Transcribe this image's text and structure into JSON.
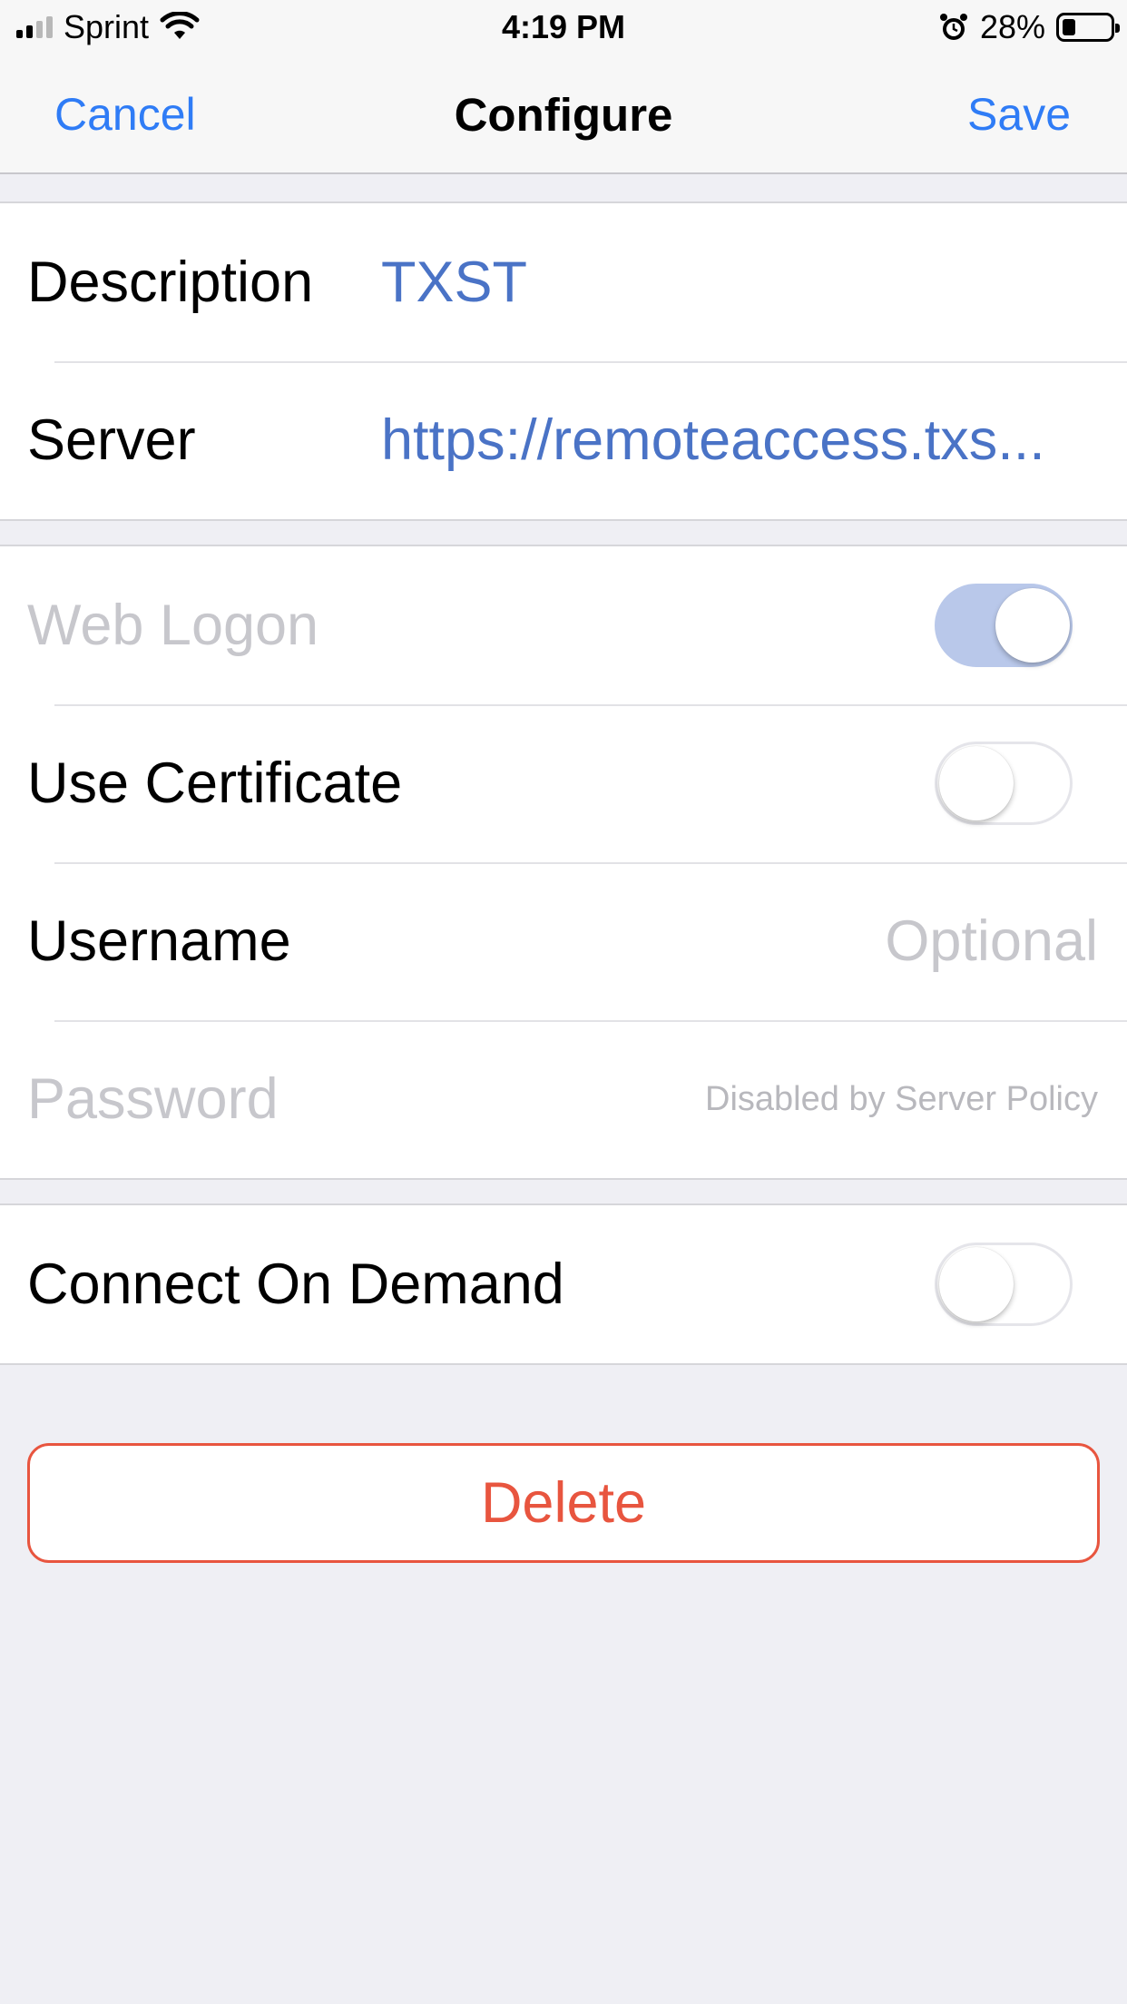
{
  "status_bar": {
    "carrier": "Sprint",
    "time": "4:19 PM",
    "battery_percent": "28%"
  },
  "nav": {
    "cancel_label": "Cancel",
    "title": "Configure",
    "save_label": "Save"
  },
  "connection": {
    "description_label": "Description",
    "description_value": "TXST",
    "server_label": "Server",
    "server_value": "https://remoteaccess.txs..."
  },
  "auth": {
    "web_logon_label": "Web Logon",
    "web_logon_on": true,
    "use_certificate_label": "Use Certificate",
    "use_certificate_on": false,
    "username_label": "Username",
    "username_placeholder": "Optional",
    "password_label": "Password",
    "password_note": "Disabled by Server Policy"
  },
  "on_demand": {
    "label": "Connect On Demand",
    "on": false
  },
  "delete_label": "Delete",
  "colors": {
    "accent_blue": "#2f7cf6",
    "value_blue": "#4a73c6",
    "destructive_red": "#e8553f",
    "background": "#efeff4"
  }
}
